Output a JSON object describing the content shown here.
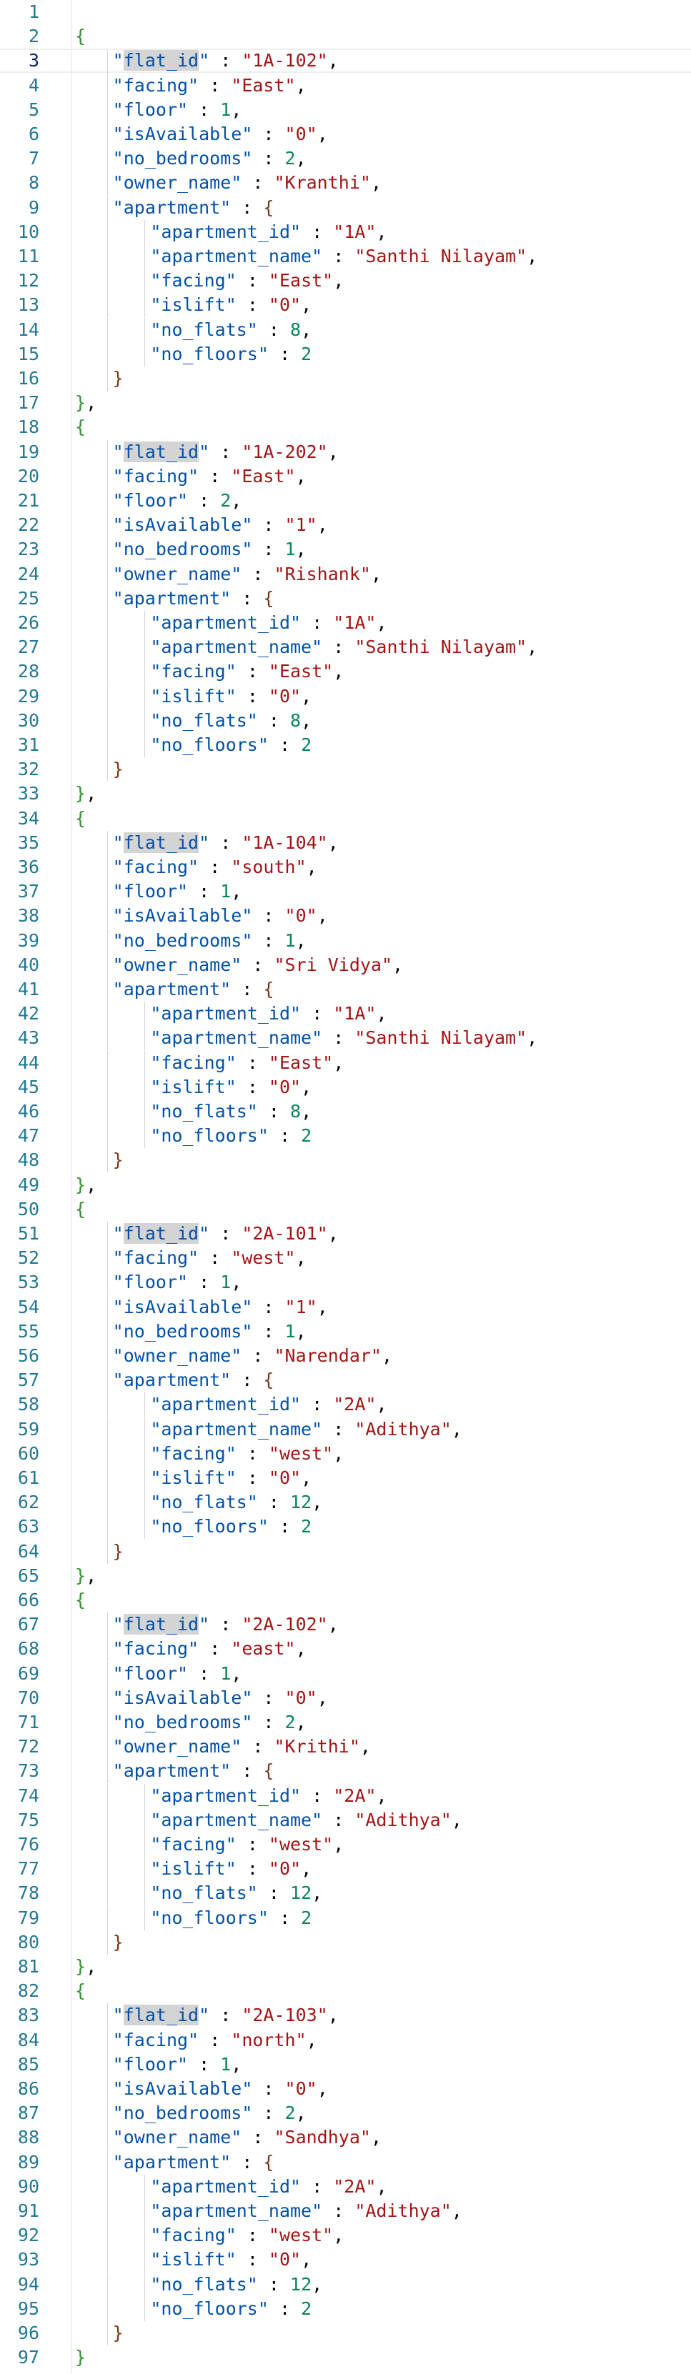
{
  "editor": {
    "items": [
      {
        "flat_id": "1A-102",
        "facing": "East",
        "floor": "1",
        "isAvailable": "0",
        "no_bedrooms": "2",
        "owner_name": "Kranthi",
        "apartment": {
          "apartment_id": "1A",
          "apartment_name": "Santhi Nilayam",
          "facing": "East",
          "islift": "0",
          "no_flats": "8",
          "no_floors": "2"
        }
      },
      {
        "flat_id": "1A-202",
        "facing": "East",
        "floor": "2",
        "isAvailable": "1",
        "no_bedrooms": "1",
        "owner_name": "Rishank",
        "apartment": {
          "apartment_id": "1A",
          "apartment_name": "Santhi Nilayam",
          "facing": "East",
          "islift": "0",
          "no_flats": "8",
          "no_floors": "2"
        }
      },
      {
        "flat_id": "1A-104",
        "facing": "south",
        "floor": "1",
        "isAvailable": "0",
        "no_bedrooms": "1",
        "owner_name": "Sri Vidya",
        "apartment": {
          "apartment_id": "1A",
          "apartment_name": "Santhi Nilayam",
          "facing": "East",
          "islift": "0",
          "no_flats": "8",
          "no_floors": "2"
        }
      },
      {
        "flat_id": "2A-101",
        "facing": "west",
        "floor": "1",
        "isAvailable": "1",
        "no_bedrooms": "1",
        "owner_name": "Narendar",
        "apartment": {
          "apartment_id": "2A",
          "apartment_name": "Adithya",
          "facing": "west",
          "islift": "0",
          "no_flats": "12",
          "no_floors": "2"
        }
      },
      {
        "flat_id": "2A-102",
        "facing": "east",
        "floor": "1",
        "isAvailable": "0",
        "no_bedrooms": "2",
        "owner_name": "Krithi",
        "apartment": {
          "apartment_id": "2A",
          "apartment_name": "Adithya",
          "facing": "west",
          "islift": "0",
          "no_flats": "12",
          "no_floors": "2"
        }
      },
      {
        "flat_id": "2A-103",
        "facing": "north",
        "floor": "1",
        "isAvailable": "0",
        "no_bedrooms": "2",
        "owner_name": "Sandhya",
        "apartment": {
          "apartment_id": "2A",
          "apartment_name": "Adithya",
          "facing": "west",
          "islift": "0",
          "no_flats": "12",
          "no_floors": "2"
        }
      }
    ],
    "highlighted_word": "flat_id",
    "current_line": "3",
    "line_count": "97",
    "colors": {
      "key": "#0451a5",
      "string": "#a31515",
      "number": "#098658",
      "brace_outer": "#319331",
      "brace_inner": "#7b3814",
      "line_number": "#237893"
    }
  }
}
